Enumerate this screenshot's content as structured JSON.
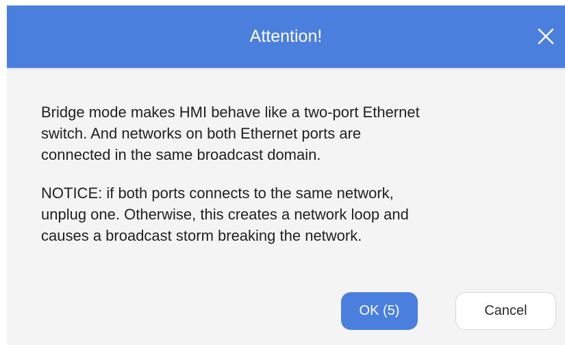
{
  "dialog": {
    "title": "Attention!",
    "close_icon": "close-icon",
    "paragraphs": [
      {
        "lines": [
          "Bridge mode makes HMI behave like a two-port Ethernet",
          "switch. And networks on both Ethernet ports are",
          "connected in the same broadcast domain."
        ]
      },
      {
        "lines": [
          "NOTICE: if both ports connects to the same network,",
          "unplug one. Otherwise, this creates a network loop and",
          "causes a broadcast storm breaking the network."
        ]
      }
    ],
    "buttons": {
      "ok_label": "OK (5)",
      "cancel_label": "Cancel"
    }
  },
  "colors": {
    "header": "#4a7fde",
    "body": "#f4f4f4",
    "primary_button": "#4a7fde",
    "text": "#1f1f1f"
  }
}
